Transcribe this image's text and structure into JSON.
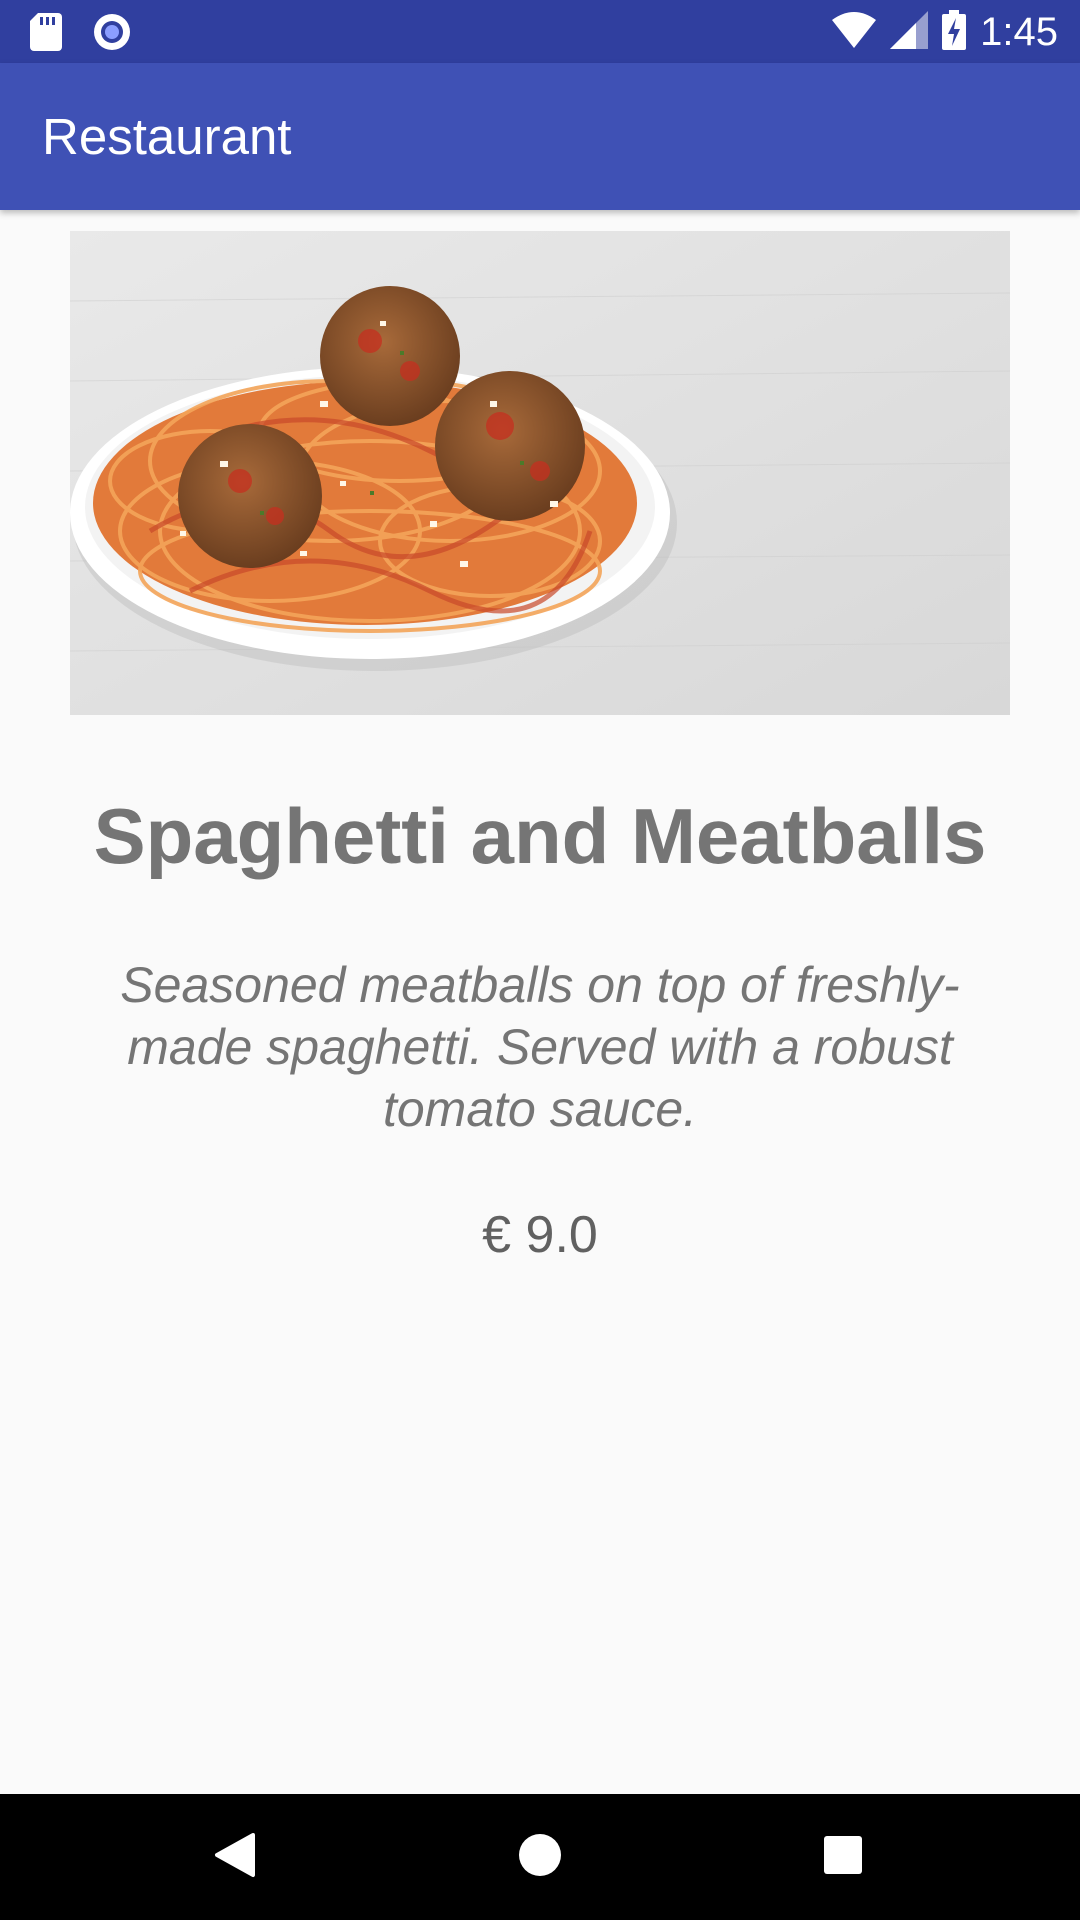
{
  "status_bar": {
    "time": "1:45",
    "icons": [
      "sd-card-icon",
      "circle-notification-icon",
      "wifi-icon",
      "signal-icon",
      "battery-charging-icon"
    ]
  },
  "app_bar": {
    "title": "Restaurant"
  },
  "dish": {
    "image": "spaghetti-meatballs-photo",
    "name": "Spaghetti and Meatballs",
    "description": "Seasoned meatballs on top of freshly-made spaghetti. Served with a robust tomato sauce.",
    "price": "€ 9.0"
  },
  "nav_bar": {
    "buttons": [
      "back-icon",
      "home-icon",
      "recents-icon"
    ]
  },
  "colors": {
    "status_bar": "#303f9f",
    "app_bar": "#3f51b5",
    "background": "#fafafa",
    "text_gray": "#757575"
  }
}
